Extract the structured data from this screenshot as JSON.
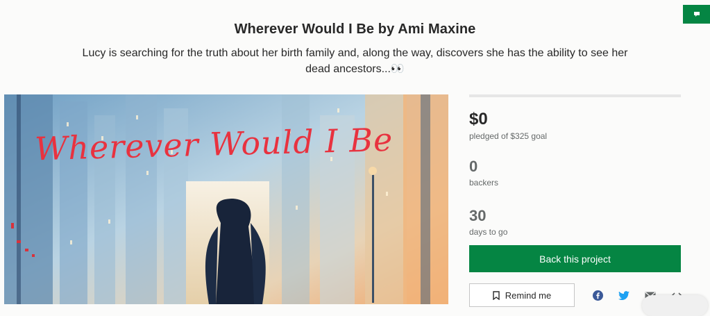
{
  "project": {
    "title": "Wherever Would I Be by Ami Maxine",
    "blurb": "Lucy is searching for the truth about her birth family and, along the way, discovers she has the ability to see her dead ancestors...👀"
  },
  "hero": {
    "cover_title": "Wherever Would I Be"
  },
  "stats": {
    "pledged": "$0",
    "pledged_label": "pledged of $325 goal",
    "progress_fraction": 0,
    "backers": "0",
    "backers_label": "backers",
    "days": "30",
    "days_label": "days to go"
  },
  "actions": {
    "back_label": "Back this project",
    "remind_label": "Remind me"
  },
  "share_icons": [
    "facebook-icon",
    "twitter-icon",
    "email-icon",
    "embed-icon"
  ],
  "colors": {
    "brand_green": "#058543",
    "cover_title_red": "#e8323f",
    "text_dark": "#282828",
    "text_muted": "#656969"
  }
}
